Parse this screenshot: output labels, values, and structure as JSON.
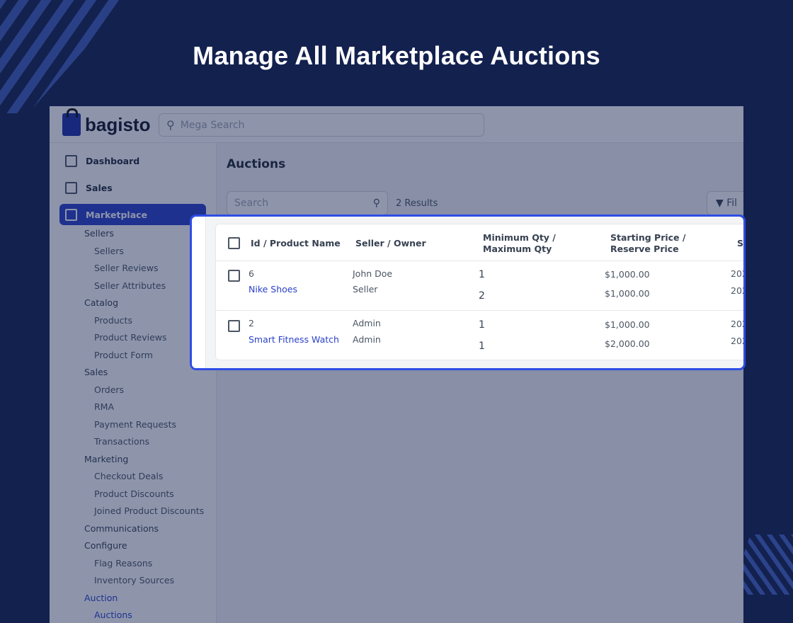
{
  "headline": "Manage All Marketplace Auctions",
  "app": {
    "logo": "bagisto",
    "search_placeholder": "Mega Search"
  },
  "sidebar": {
    "top_items": [
      {
        "label": "Dashboard",
        "icon": "dashboard-icon"
      },
      {
        "label": "Sales",
        "icon": "sales-icon"
      },
      {
        "label": "Marketplace",
        "icon": "marketplace-icon",
        "active": true
      }
    ],
    "groups": [
      {
        "label": "Sellers",
        "items": [
          "Sellers",
          "Seller Reviews",
          "Seller Attributes"
        ]
      },
      {
        "label": "Catalog",
        "items": [
          "Products",
          "Product Reviews",
          "Product Form"
        ]
      },
      {
        "label": "Sales",
        "items": [
          "Orders",
          "RMA",
          "Payment Requests",
          "Transactions"
        ]
      },
      {
        "label": "Marketing",
        "items": [
          "Checkout Deals",
          "Product Discounts",
          "Joined Product Discounts"
        ]
      },
      {
        "label": "Communications",
        "items": []
      },
      {
        "label": "Configure",
        "items": [
          "Flag Reasons",
          "Inventory Sources"
        ]
      },
      {
        "label": "Auction",
        "items": [
          "Auctions"
        ]
      }
    ]
  },
  "main": {
    "title": "Auctions",
    "search_placeholder": "Search",
    "results": "2 Results",
    "filter_label": "Fil"
  },
  "table": {
    "headers": {
      "id_name": "Id / Product Name",
      "seller": "Seller / Owner",
      "qty_1": "Minimum Qty /",
      "qty_2": "Maximum Qty",
      "price_1": "Starting Price /",
      "price_2": "Reserve Price",
      "extra": "S"
    },
    "rows": [
      {
        "id": "6",
        "name": "Nike Shoes",
        "seller": "John Doe",
        "owner": "Seller",
        "min_qty": "1",
        "max_qty": "2",
        "start_price": "$1,000.00",
        "reserve_price": "$1,000.00",
        "date1": "202",
        "date2": "202"
      },
      {
        "id": "2",
        "name": "Smart Fitness Watch",
        "seller": "Admin",
        "owner": "Admin",
        "min_qty": "1",
        "max_qty": "1",
        "start_price": "$1,000.00",
        "reserve_price": "$2,000.00",
        "date1": "202",
        "date2": "202"
      }
    ]
  },
  "colors": {
    "background": "#13214f",
    "accent": "#2a40c8",
    "highlight_border": "#2f4de6"
  }
}
